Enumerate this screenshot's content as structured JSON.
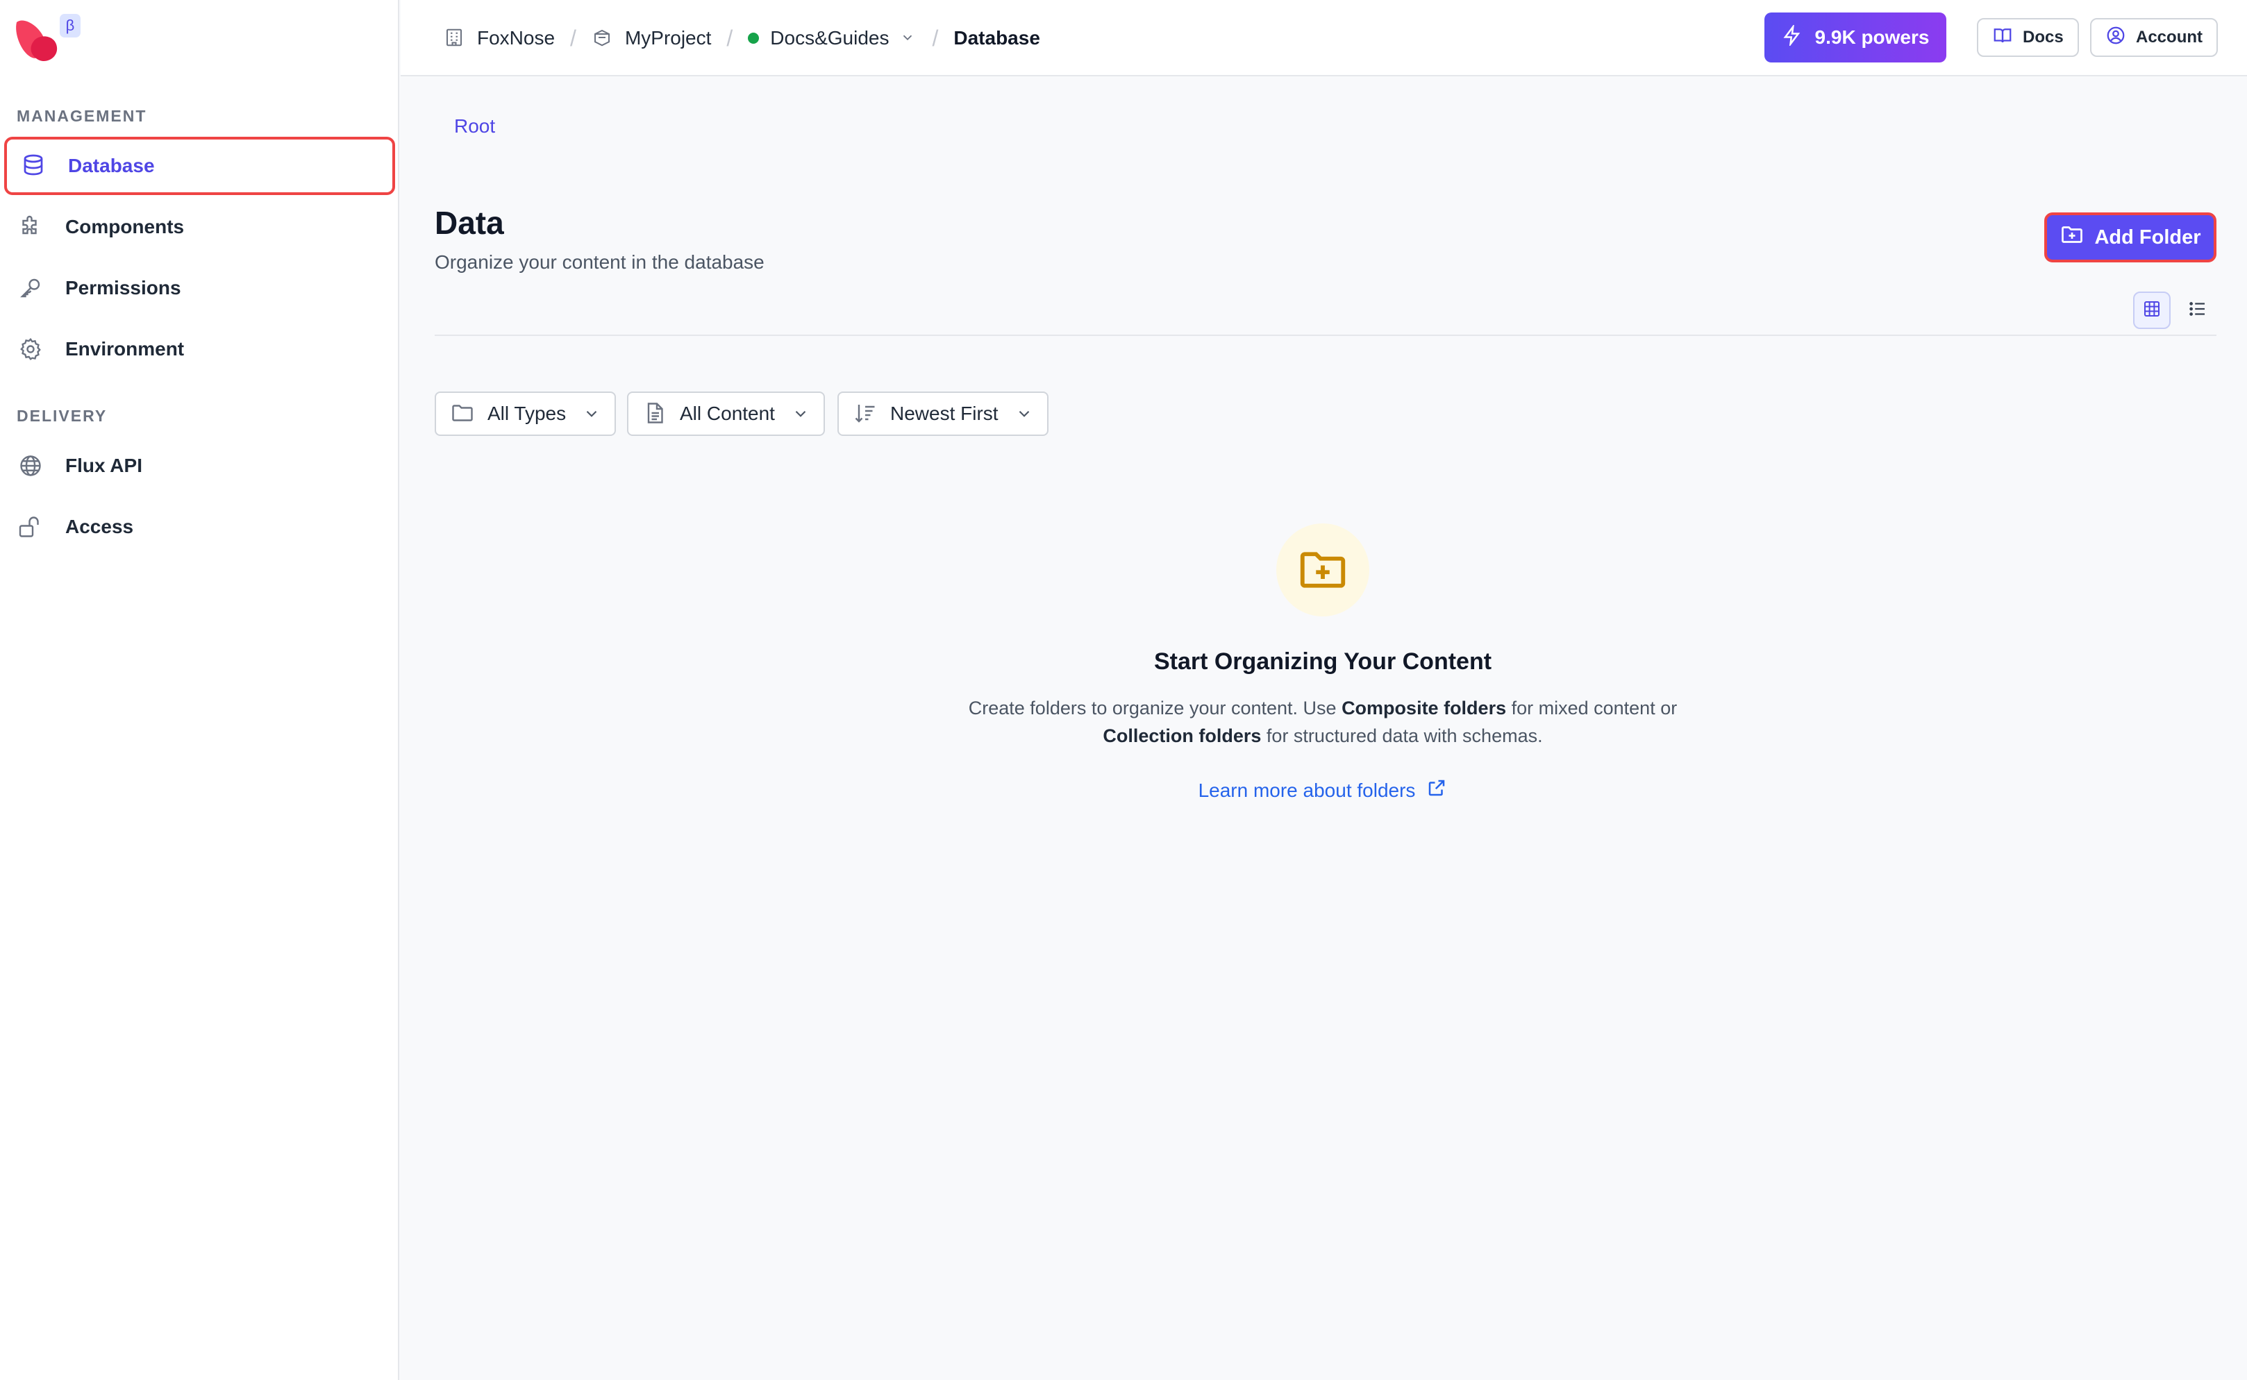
{
  "app": {
    "beta_badge": "β"
  },
  "sidebar": {
    "sections": [
      {
        "label": "MANAGEMENT"
      },
      {
        "label": "DELIVERY"
      }
    ],
    "items": [
      {
        "label": "Database",
        "icon": "database-icon",
        "active": true
      },
      {
        "label": "Components",
        "icon": "puzzle-icon",
        "active": false
      },
      {
        "label": "Permissions",
        "icon": "key-icon",
        "active": false
      },
      {
        "label": "Environment",
        "icon": "gear-icon",
        "active": false
      },
      {
        "label": "Flux API",
        "icon": "globe-icon",
        "active": false
      },
      {
        "label": "Access",
        "icon": "unlock-icon",
        "active": false
      }
    ]
  },
  "topbar": {
    "breadcrumbs": [
      {
        "label": "FoxNose",
        "icon": "building-icon"
      },
      {
        "label": "MyProject",
        "icon": "box-icon"
      },
      {
        "label": "Docs&Guides",
        "icon": "status-dot"
      },
      {
        "label": "Database"
      }
    ],
    "powers_label": "9.9K powers",
    "docs_label": "Docs",
    "account_label": "Account"
  },
  "main": {
    "root_link": "Root",
    "title": "Data",
    "subtitle": "Organize your content in the database",
    "add_folder_label": "Add Folder",
    "filters": [
      {
        "label": "All Types",
        "icon": "folder-icon"
      },
      {
        "label": "All Content",
        "icon": "document-icon"
      },
      {
        "label": "Newest First",
        "icon": "sort-icon"
      }
    ],
    "empty_state": {
      "title": "Start Organizing Your Content",
      "desc_part1": "Create folders to organize your content. Use ",
      "desc_bold1": "Composite folders",
      "desc_part2": " for mixed content or",
      "desc_bold2": "Collection folders",
      "desc_part3": " for structured data with schemas.",
      "link_label": "Learn more about folders"
    }
  },
  "colors": {
    "accent": "#5b4cf2",
    "highlight": "#ef4444",
    "link": "#2563eb",
    "status_green": "#16a34a",
    "empty_icon": "#ca8a04"
  }
}
